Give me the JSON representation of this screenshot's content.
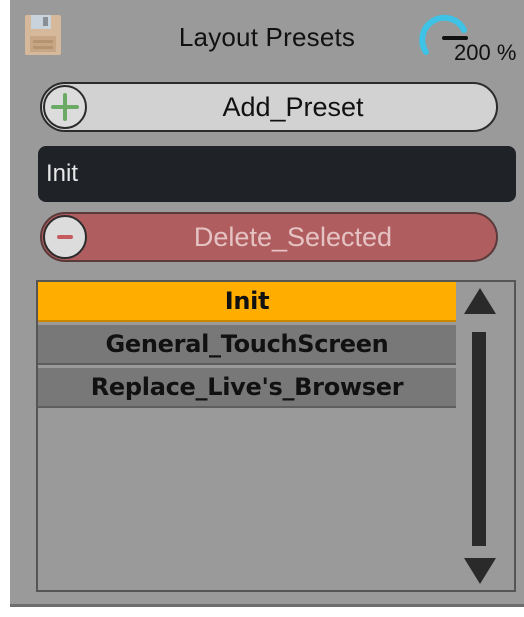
{
  "header": {
    "title": "Layout Presets",
    "zoom_label": "200 %",
    "save_icon": "floppy-disk-icon"
  },
  "add_button": {
    "label": "Add_Preset",
    "icon": "plus-icon",
    "icon_color": "#6aaa64"
  },
  "name_field": {
    "value": "Init"
  },
  "delete_button": {
    "label": "Delete_Selected",
    "icon": "minus-icon",
    "icon_color": "#c65b5f"
  },
  "preset_list": {
    "items": [
      {
        "label": "Init",
        "selected": true
      },
      {
        "label": "General_TouchScreen",
        "selected": false
      },
      {
        "label": "Replace_Live's_Browser",
        "selected": false
      }
    ]
  },
  "colors": {
    "panel": "#9a9a9a",
    "selected": "#ffae00",
    "accent": "#3ec3e6",
    "delete": "#b05d5f"
  }
}
